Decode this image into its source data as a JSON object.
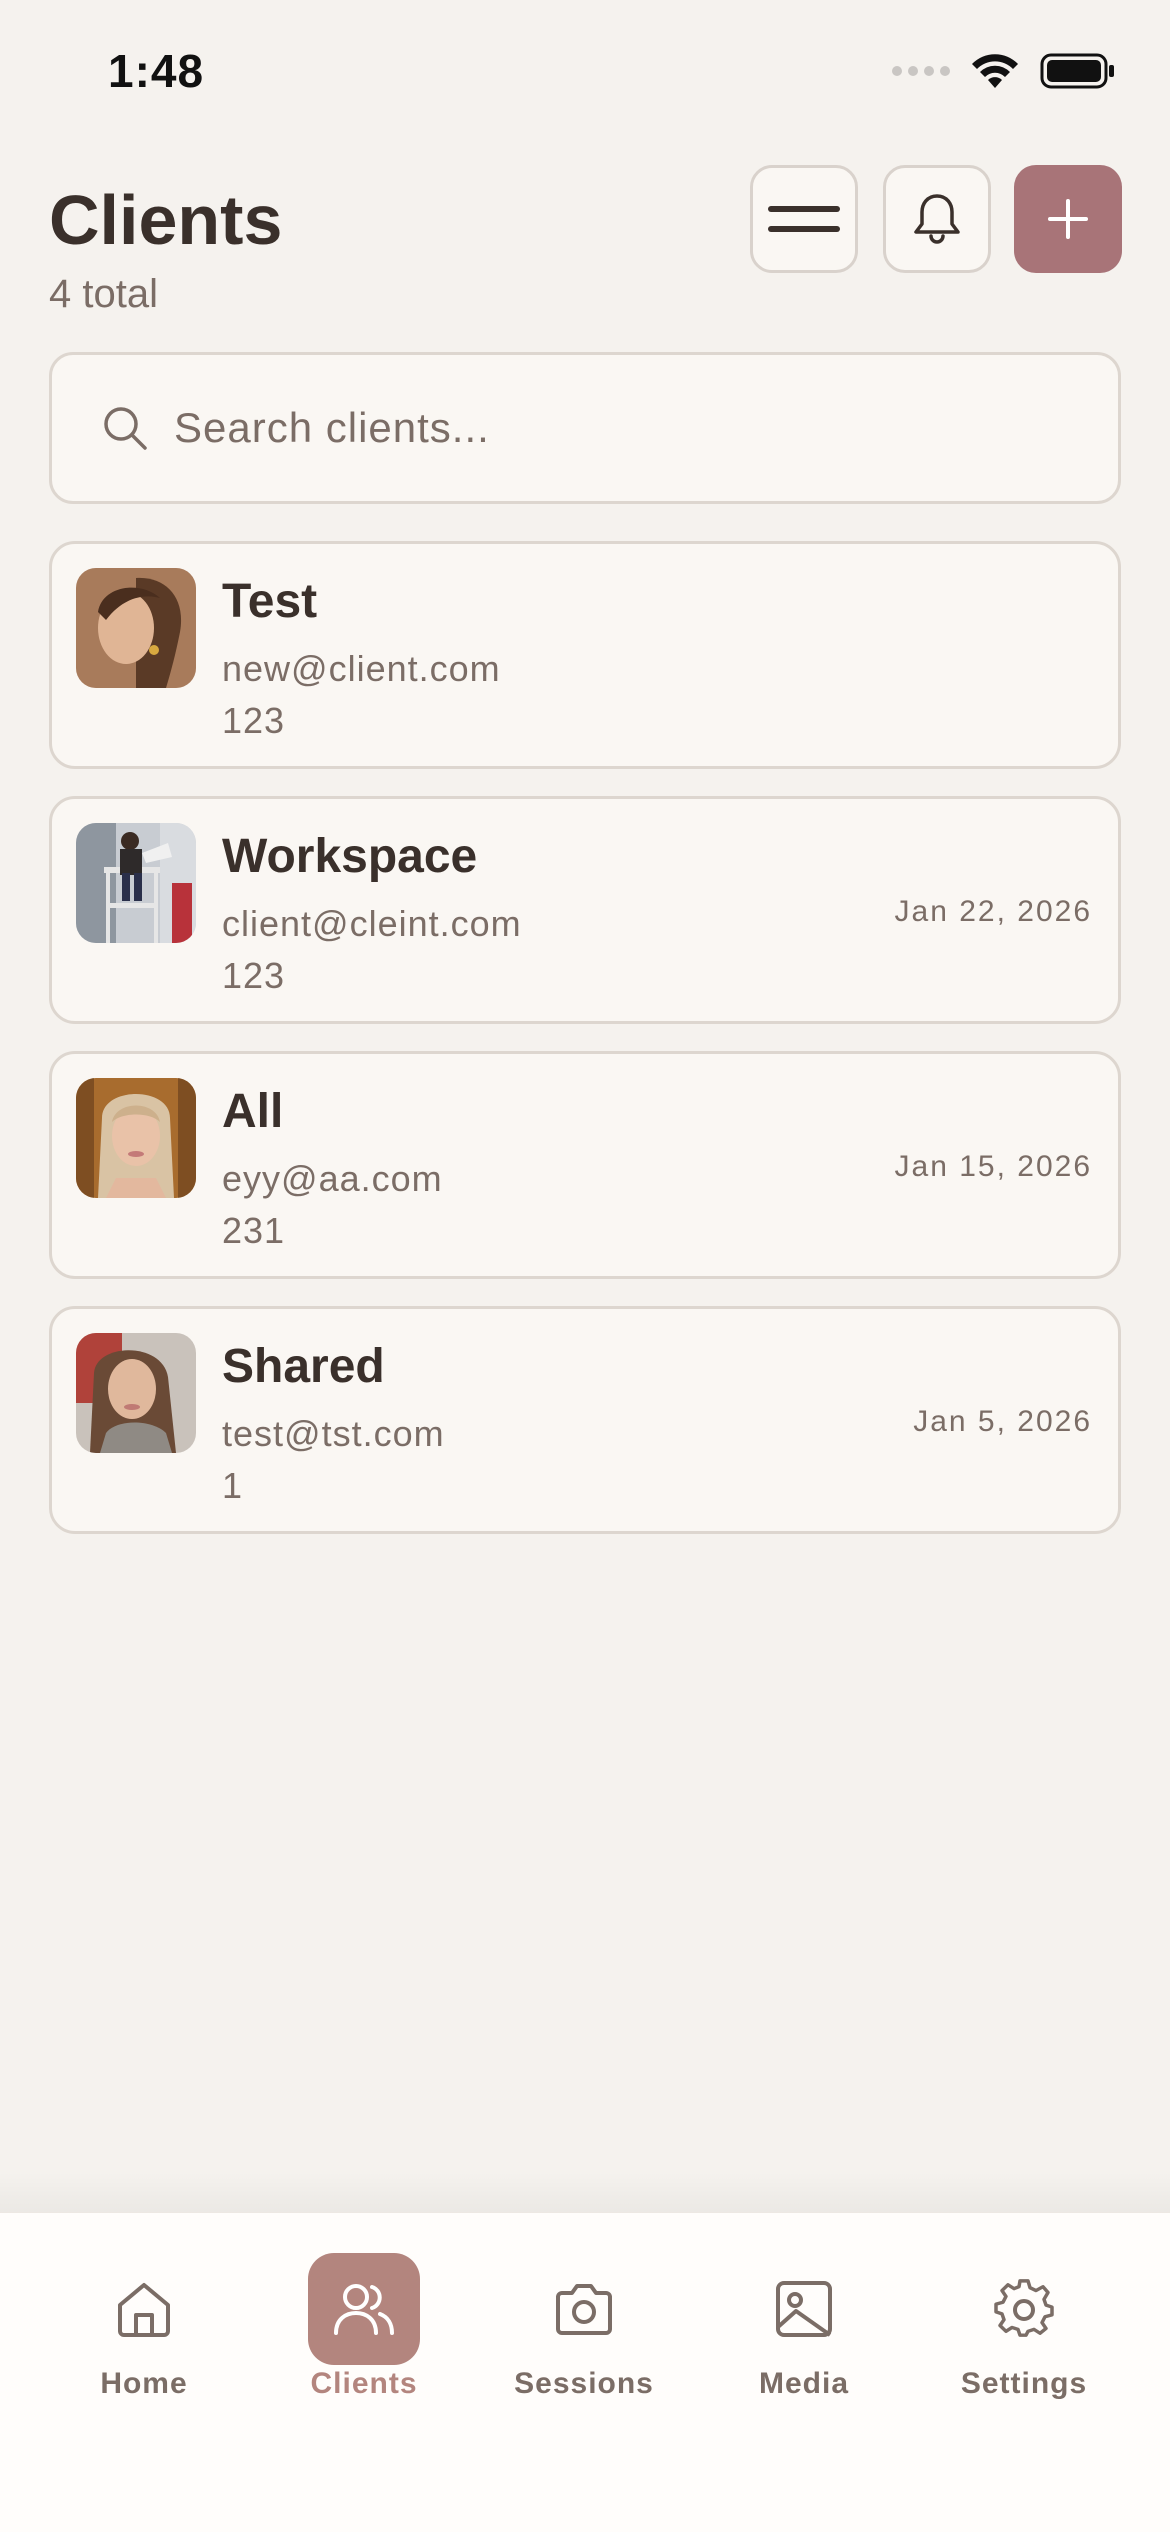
{
  "status_bar": {
    "time": "1:48"
  },
  "header": {
    "title": "Clients",
    "subtitle": "4 total",
    "menu_icon": "hamburger-icon",
    "bell_icon": "bell-icon",
    "add_icon": "plus-icon"
  },
  "search": {
    "placeholder": "Search clients..."
  },
  "clients": [
    {
      "name": "Test",
      "email": "new@client.com",
      "phone": "123",
      "date": ""
    },
    {
      "name": "Workspace",
      "email": "client@cleint.com",
      "phone": "123",
      "date": "Jan 22, 2026"
    },
    {
      "name": "All",
      "email": "eyy@aa.com",
      "phone": "231",
      "date": "Jan 15, 2026"
    },
    {
      "name": "Shared",
      "email": "test@tst.com",
      "phone": "1",
      "date": "Jan 5, 2026"
    }
  ],
  "tabbar": {
    "tabs": [
      {
        "label": "Home",
        "icon": "home-icon"
      },
      {
        "label": "Clients",
        "icon": "users-icon",
        "active": true
      },
      {
        "label": "Sessions",
        "icon": "camera-icon"
      },
      {
        "label": "Media",
        "icon": "image-icon"
      },
      {
        "label": "Settings",
        "icon": "gear-icon"
      }
    ]
  },
  "colors": {
    "accent": "#a87478",
    "active_tab": "#b3857e",
    "background": "#f5f2ee",
    "card": "#faf7f3"
  }
}
